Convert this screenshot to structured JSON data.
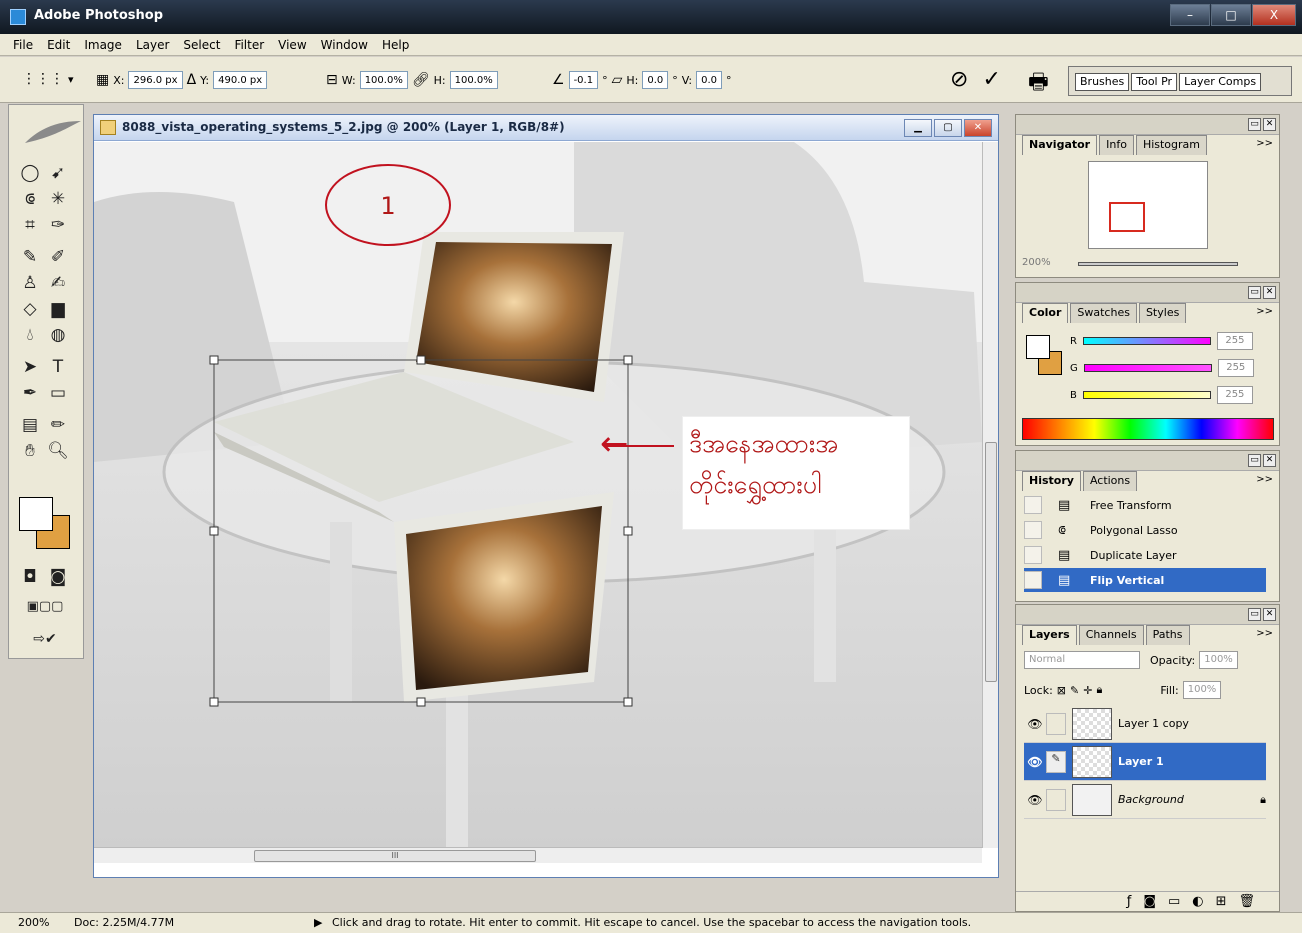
{
  "window": {
    "title": "Adobe Photoshop",
    "min": "–",
    "max": "□",
    "close": "X"
  },
  "menu": [
    "File",
    "Edit",
    "Image",
    "Layer",
    "Select",
    "Filter",
    "View",
    "Window",
    "Help"
  ],
  "options": {
    "x_label": "X:",
    "x_value": "296.0 px",
    "delta": "Δ",
    "y_label": "Y:",
    "y_value": "490.0 px",
    "w_label": "W:",
    "w_value": "100.0%",
    "h_label": "H:",
    "h_value": "100.0%",
    "angle_value": "-0.1",
    "degree": "°",
    "skew_h_label": "H:",
    "skew_h_value": "0.0",
    "skew_v_label": "V:",
    "skew_v_value": "0.0",
    "cancel_symbol": "⃠",
    "commit_symbol": "✓"
  },
  "palette_well": [
    "Brushes",
    "Tool Pr",
    "Layer Comps"
  ],
  "document": {
    "title": "8088_vista_operating_systems_5_2.jpg @ 200% (Layer 1, RGB/8#)",
    "annotation_text_line1": "ဒီအနေအထားအ",
    "annotation_text_line2": "တိုင်းရွှေ့ထားပါ",
    "arrow": "←",
    "step_number": "1",
    "hscroll_grip": "III"
  },
  "navigator": {
    "tabs": [
      "Navigator",
      "Info",
      "Histogram"
    ],
    "zoom": "200%",
    "more": ">>"
  },
  "color": {
    "tabs": [
      "Color",
      "Swatches",
      "Styles"
    ],
    "channels": [
      {
        "label": "R",
        "value": "255"
      },
      {
        "label": "G",
        "value": "255"
      },
      {
        "label": "B",
        "value": "255"
      }
    ],
    "bg_color": "#e0a042"
  },
  "history": {
    "tabs": [
      "History",
      "Actions"
    ],
    "items": [
      "Free Transform",
      "Polygonal Lasso",
      "Duplicate Layer",
      "Flip Vertical"
    ]
  },
  "layers": {
    "tabs": [
      "Layers",
      "Channels",
      "Paths"
    ],
    "blend_mode": "Normal",
    "opacity_label": "Opacity:",
    "opacity_value": "100%",
    "lock_label": "Lock:",
    "fill_label": "Fill:",
    "fill_value": "100%",
    "items": [
      "Layer 1 copy",
      "Layer 1",
      "Background"
    ]
  },
  "status": {
    "zoom": "200%",
    "doc": "Doc: 2.25M/4.77M",
    "message": "Click and drag to rotate. Hit enter to commit. Hit escape to cancel. Use the spacebar to access the navigation tools."
  },
  "colors": {
    "selection": "#316ac5",
    "annotation_red": "#b01717",
    "accent_orange": "#e0a042"
  }
}
